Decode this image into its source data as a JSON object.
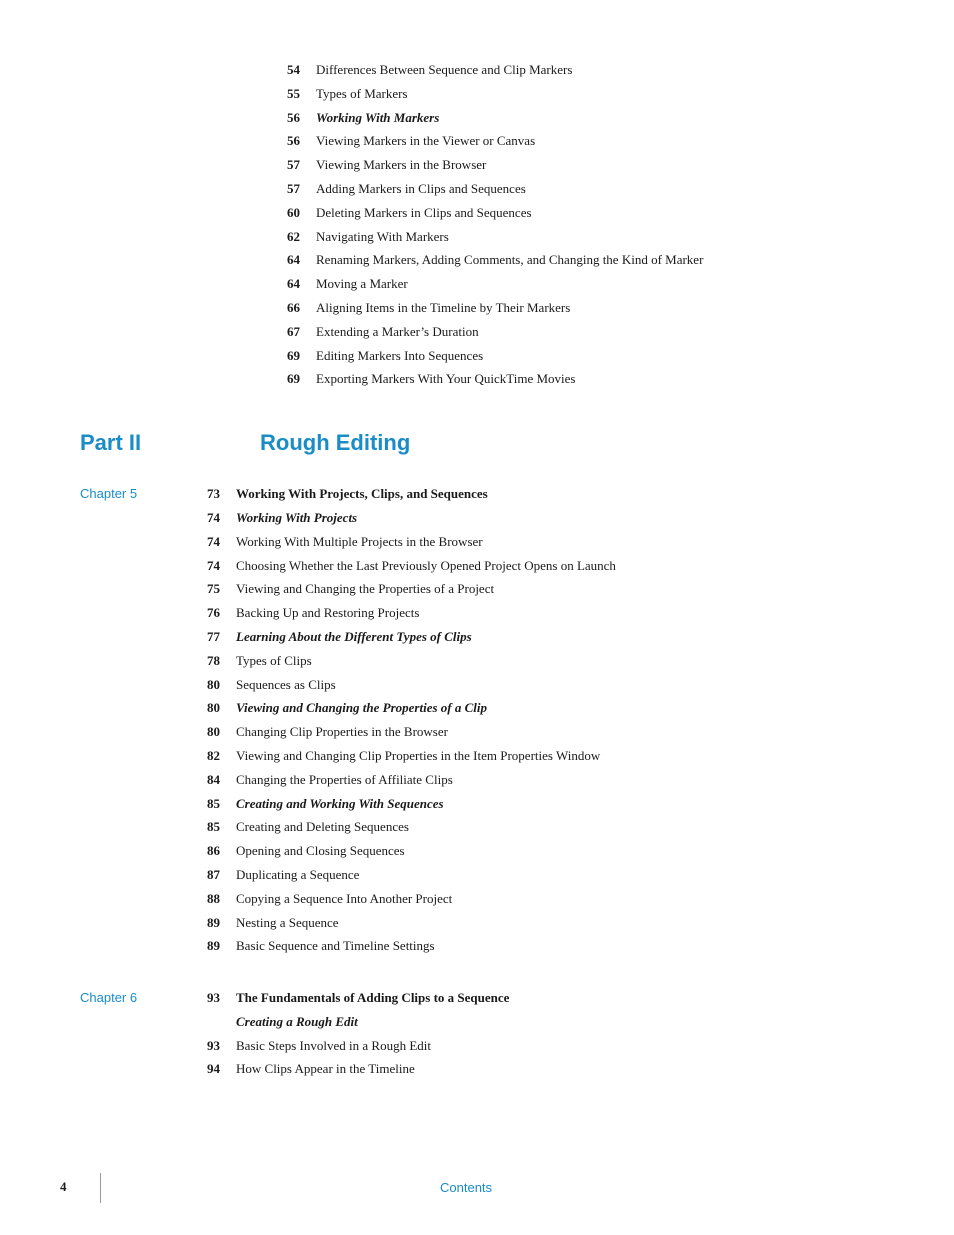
{
  "continuation": {
    "entries": [
      {
        "page": "54",
        "text": "Differences Between Sequence and Clip Markers",
        "style": "normal"
      },
      {
        "page": "55",
        "text": "Types of Markers",
        "style": "normal"
      },
      {
        "page": "56",
        "text": "Working With Markers",
        "style": "bold-italic"
      },
      {
        "page": "56",
        "text": "Viewing Markers in the Viewer or Canvas",
        "style": "normal"
      },
      {
        "page": "57",
        "text": "Viewing Markers in the Browser",
        "style": "normal"
      },
      {
        "page": "57",
        "text": "Adding Markers in Clips and Sequences",
        "style": "normal"
      },
      {
        "page": "60",
        "text": "Deleting Markers in Clips and Sequences",
        "style": "normal"
      },
      {
        "page": "62",
        "text": "Navigating With Markers",
        "style": "normal"
      },
      {
        "page": "64",
        "text": "Renaming Markers, Adding Comments, and Changing the Kind of Marker",
        "style": "normal"
      },
      {
        "page": "64",
        "text": "Moving a Marker",
        "style": "normal"
      },
      {
        "page": "66",
        "text": "Aligning Items in the Timeline by Their Markers",
        "style": "normal"
      },
      {
        "page": "67",
        "text": "Extending a Marker’s Duration",
        "style": "normal"
      },
      {
        "page": "69",
        "text": "Editing Markers Into Sequences",
        "style": "normal"
      },
      {
        "page": "69",
        "text": "Exporting Markers With Your QuickTime Movies",
        "style": "normal"
      }
    ]
  },
  "part": {
    "label": "Part II",
    "title": "Rough Editing"
  },
  "chapters": [
    {
      "label": "Chapter 5",
      "entries": [
        {
          "page": "73",
          "text": "Working With Projects, Clips, and Sequences",
          "style": "bold"
        },
        {
          "page": "74",
          "text": "Working With Projects",
          "style": "bold-italic"
        },
        {
          "page": "74",
          "text": "Working With Multiple Projects in the Browser",
          "style": "normal"
        },
        {
          "page": "74",
          "text": "Choosing Whether the Last Previously Opened Project Opens on Launch",
          "style": "normal"
        },
        {
          "page": "75",
          "text": "Viewing and Changing the Properties of a Project",
          "style": "normal"
        },
        {
          "page": "76",
          "text": "Backing Up and Restoring Projects",
          "style": "normal"
        },
        {
          "page": "77",
          "text": "Learning About the Different Types of Clips",
          "style": "bold-italic"
        },
        {
          "page": "78",
          "text": "Types of Clips",
          "style": "normal"
        },
        {
          "page": "80",
          "text": "Sequences as Clips",
          "style": "normal"
        },
        {
          "page": "80",
          "text": "Viewing and Changing the Properties of a Clip",
          "style": "bold-italic"
        },
        {
          "page": "80",
          "text": "Changing Clip Properties in the Browser",
          "style": "normal"
        },
        {
          "page": "82",
          "text": "Viewing and Changing Clip Properties in the Item Properties Window",
          "style": "normal"
        },
        {
          "page": "84",
          "text": "Changing the Properties of Affiliate Clips",
          "style": "normal"
        },
        {
          "page": "85",
          "text": "Creating and Working With Sequences",
          "style": "bold-italic"
        },
        {
          "page": "85",
          "text": "Creating and Deleting Sequences",
          "style": "normal"
        },
        {
          "page": "86",
          "text": "Opening and Closing Sequences",
          "style": "normal"
        },
        {
          "page": "87",
          "text": "Duplicating a Sequence",
          "style": "normal"
        },
        {
          "page": "88",
          "text": "Copying a Sequence Into Another Project",
          "style": "normal"
        },
        {
          "page": "89",
          "text": "Nesting a Sequence",
          "style": "normal"
        },
        {
          "page": "89",
          "text": "Basic Sequence and Timeline Settings",
          "style": "normal"
        }
      ]
    },
    {
      "label": "Chapter 6",
      "entries": [
        {
          "page": "93",
          "text": "The Fundamentals of Adding Clips to a Sequence",
          "style": "bold"
        },
        {
          "page": "",
          "text": "Creating a Rough Edit",
          "style": "bold-italic"
        },
        {
          "page": "93",
          "text": "Basic Steps Involved in a Rough Edit",
          "style": "normal"
        },
        {
          "page": "94",
          "text": "How Clips Appear in the Timeline",
          "style": "normal"
        }
      ]
    }
  ],
  "footer": {
    "page_num": "4",
    "title": "Contents"
  }
}
